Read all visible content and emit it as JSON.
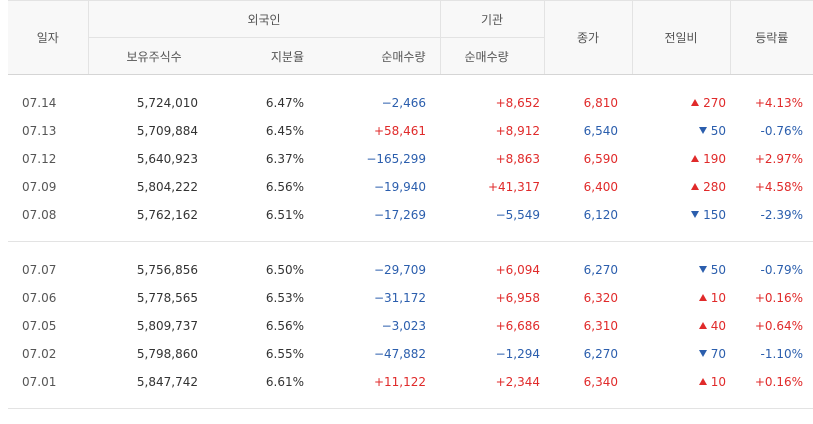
{
  "header": {
    "date": "일자",
    "foreign": "외국인",
    "institution": "기관",
    "close": "종가",
    "change": "전일비",
    "rate": "등락률",
    "holdings": "보유주식수",
    "share": "지분율",
    "foreign_net": "순매수량",
    "inst_net": "순매수량"
  },
  "colors": {
    "up": "#e02a2a",
    "down": "#2b5ead"
  },
  "groups": [
    {
      "rows": [
        {
          "date": "07.14",
          "holdings": "5,724,010",
          "share": "6.47%",
          "foreign_net": "−2,466",
          "foreign_dir": "down",
          "inst_net": "+8,652",
          "inst_dir": "up",
          "close": "6,810",
          "close_dir": "up",
          "change": "270",
          "change_dir": "up",
          "rate": "+4.13%",
          "rate_dir": "up"
        },
        {
          "date": "07.13",
          "holdings": "5,709,884",
          "share": "6.45%",
          "foreign_net": "+58,461",
          "foreign_dir": "up",
          "inst_net": "+8,912",
          "inst_dir": "up",
          "close": "6,540",
          "close_dir": "down",
          "change": "50",
          "change_dir": "down",
          "rate": "-0.76%",
          "rate_dir": "down"
        },
        {
          "date": "07.12",
          "holdings": "5,640,923",
          "share": "6.37%",
          "foreign_net": "−165,299",
          "foreign_dir": "down",
          "inst_net": "+8,863",
          "inst_dir": "up",
          "close": "6,590",
          "close_dir": "up",
          "change": "190",
          "change_dir": "up",
          "rate": "+2.97%",
          "rate_dir": "up"
        },
        {
          "date": "07.09",
          "holdings": "5,804,222",
          "share": "6.56%",
          "foreign_net": "−19,940",
          "foreign_dir": "down",
          "inst_net": "+41,317",
          "inst_dir": "up",
          "close": "6,400",
          "close_dir": "up",
          "change": "280",
          "change_dir": "up",
          "rate": "+4.58%",
          "rate_dir": "up"
        },
        {
          "date": "07.08",
          "holdings": "5,762,162",
          "share": "6.51%",
          "foreign_net": "−17,269",
          "foreign_dir": "down",
          "inst_net": "−5,549",
          "inst_dir": "down",
          "close": "6,120",
          "close_dir": "down",
          "change": "150",
          "change_dir": "down",
          "rate": "-2.39%",
          "rate_dir": "down"
        }
      ]
    },
    {
      "rows": [
        {
          "date": "07.07",
          "holdings": "5,756,856",
          "share": "6.50%",
          "foreign_net": "−29,709",
          "foreign_dir": "down",
          "inst_net": "+6,094",
          "inst_dir": "up",
          "close": "6,270",
          "close_dir": "down",
          "change": "50",
          "change_dir": "down",
          "rate": "-0.79%",
          "rate_dir": "down"
        },
        {
          "date": "07.06",
          "holdings": "5,778,565",
          "share": "6.53%",
          "foreign_net": "−31,172",
          "foreign_dir": "down",
          "inst_net": "+6,958",
          "inst_dir": "up",
          "close": "6,320",
          "close_dir": "up",
          "change": "10",
          "change_dir": "up",
          "rate": "+0.16%",
          "rate_dir": "up"
        },
        {
          "date": "07.05",
          "holdings": "5,809,737",
          "share": "6.56%",
          "foreign_net": "−3,023",
          "foreign_dir": "down",
          "inst_net": "+6,686",
          "inst_dir": "up",
          "close": "6,310",
          "close_dir": "up",
          "change": "40",
          "change_dir": "up",
          "rate": "+0.64%",
          "rate_dir": "up"
        },
        {
          "date": "07.02",
          "holdings": "5,798,860",
          "share": "6.55%",
          "foreign_net": "−47,882",
          "foreign_dir": "down",
          "inst_net": "−1,294",
          "inst_dir": "down",
          "close": "6,270",
          "close_dir": "down",
          "change": "70",
          "change_dir": "down",
          "rate": "-1.10%",
          "rate_dir": "down"
        },
        {
          "date": "07.01",
          "holdings": "5,847,742",
          "share": "6.61%",
          "foreign_net": "+11,122",
          "foreign_dir": "up",
          "inst_net": "+2,344",
          "inst_dir": "up",
          "close": "6,340",
          "close_dir": "up",
          "change": "10",
          "change_dir": "up",
          "rate": "+0.16%",
          "rate_dir": "up"
        }
      ]
    }
  ]
}
